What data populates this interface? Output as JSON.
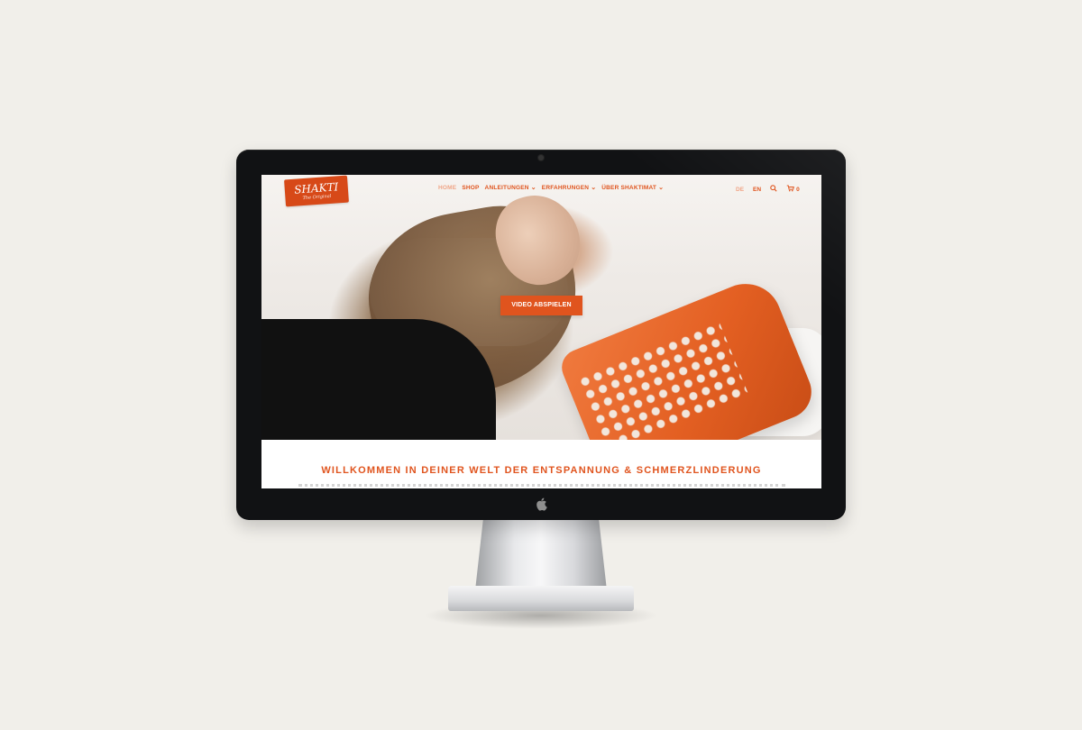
{
  "site": {
    "logo": {
      "text": "SHAKTI",
      "subtext": "The Original"
    },
    "nav": [
      {
        "label": "Home",
        "active": true,
        "dropdown": false
      },
      {
        "label": "Shop",
        "active": false,
        "dropdown": false
      },
      {
        "label": "Anleitungen",
        "active": false,
        "dropdown": true
      },
      {
        "label": "Erfahrungen",
        "active": false,
        "dropdown": true
      },
      {
        "label": "Über Shaktimat",
        "active": false,
        "dropdown": true
      }
    ],
    "utils": {
      "lang_de": "DE",
      "lang_en": "EN",
      "cart_count": "0"
    },
    "hero": {
      "video_button": "Video abspielen"
    },
    "headline": "Willkommen in deiner Welt der Entspannung & Schmerzlinderung"
  },
  "colors": {
    "accent": "#e0541e",
    "accent_light": "#f0a587",
    "backdrop": "#f1efea",
    "bezel": "#111214"
  },
  "icons": {
    "search": "search-icon",
    "cart": "cart-icon",
    "apple": "apple-logo-icon"
  }
}
